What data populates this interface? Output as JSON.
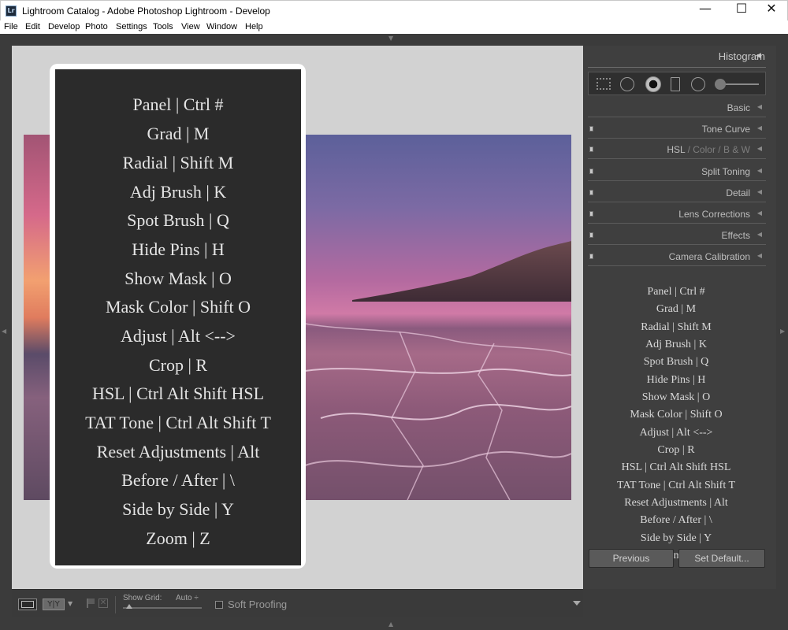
{
  "window": {
    "app_icon_text": "Lr",
    "title": "Lightroom Catalog - Adobe Photoshop Lightroom - Develop",
    "minimize_glyph": "—",
    "maximize_glyph": "☐",
    "close_glyph": "✕"
  },
  "menu": [
    "File",
    "Edit",
    "Develop",
    "Photo",
    "Settings",
    "Tools",
    "View",
    "Window",
    "Help"
  ],
  "overlay": {
    "lines": [
      "Panel | Ctrl #",
      "Grad | M",
      "Radial | Shift M",
      "Adj Brush | K",
      "Spot Brush | Q",
      "Hide Pins | H",
      "Show Mask | O",
      "Mask Color | Shift O",
      "Adjust | Alt <-->",
      "Crop | R",
      "HSL | Ctrl Alt Shift HSL",
      "TAT Tone | Ctrl Alt Shift T",
      "Reset Adjustments | Alt",
      "Before / After | \\",
      "Side by Side | Y",
      "Zoom | Z"
    ]
  },
  "right_panel": {
    "histogram_label": "Histogram",
    "tools": [
      "grid-overlay-icon",
      "spot-removal-icon",
      "red-eye-icon",
      "graduated-filter-icon",
      "radial-filter-icon",
      "adjustment-brush-icon"
    ],
    "sections": [
      "Basic",
      "Tone Curve",
      "HSL / Color / B&W",
      "Split Toning",
      "Detail",
      "Lens Corrections",
      "Effects",
      "Camera Calibration"
    ],
    "hsl_parts": [
      "HSL",
      "/",
      "Color",
      "/",
      "B & W"
    ],
    "shortcut_lines": [
      "Panel | Ctrl #",
      "Grad | M",
      "Radial | Shift M",
      "Adj Brush | K",
      "Spot Brush | Q",
      "Hide Pins | H",
      "Show Mask | O",
      "Mask Color | Shift O",
      "Adjust | Alt <-->",
      "Crop | R",
      "HSL | Ctrl Alt Shift HSL",
      "TAT Tone | Ctrl Alt Shift T",
      "Reset Adjustments | Alt",
      "Before / After | \\",
      "Side by Side | Y",
      "Zoom | Z"
    ],
    "previous_button": "Previous",
    "set_default_button": "Set Default..."
  },
  "toolbar": {
    "before_after_label": "Y|Y",
    "reject_glyph": "✕",
    "show_grid_label": "Show Grid:",
    "show_grid_value": "Auto ÷",
    "soft_proofing_label": "Soft Proofing"
  },
  "colors": {
    "panel_bg": "#3f3f3f",
    "image_area_bg": "#d2d2d2",
    "overlay_bg": "#2b2b2b"
  }
}
